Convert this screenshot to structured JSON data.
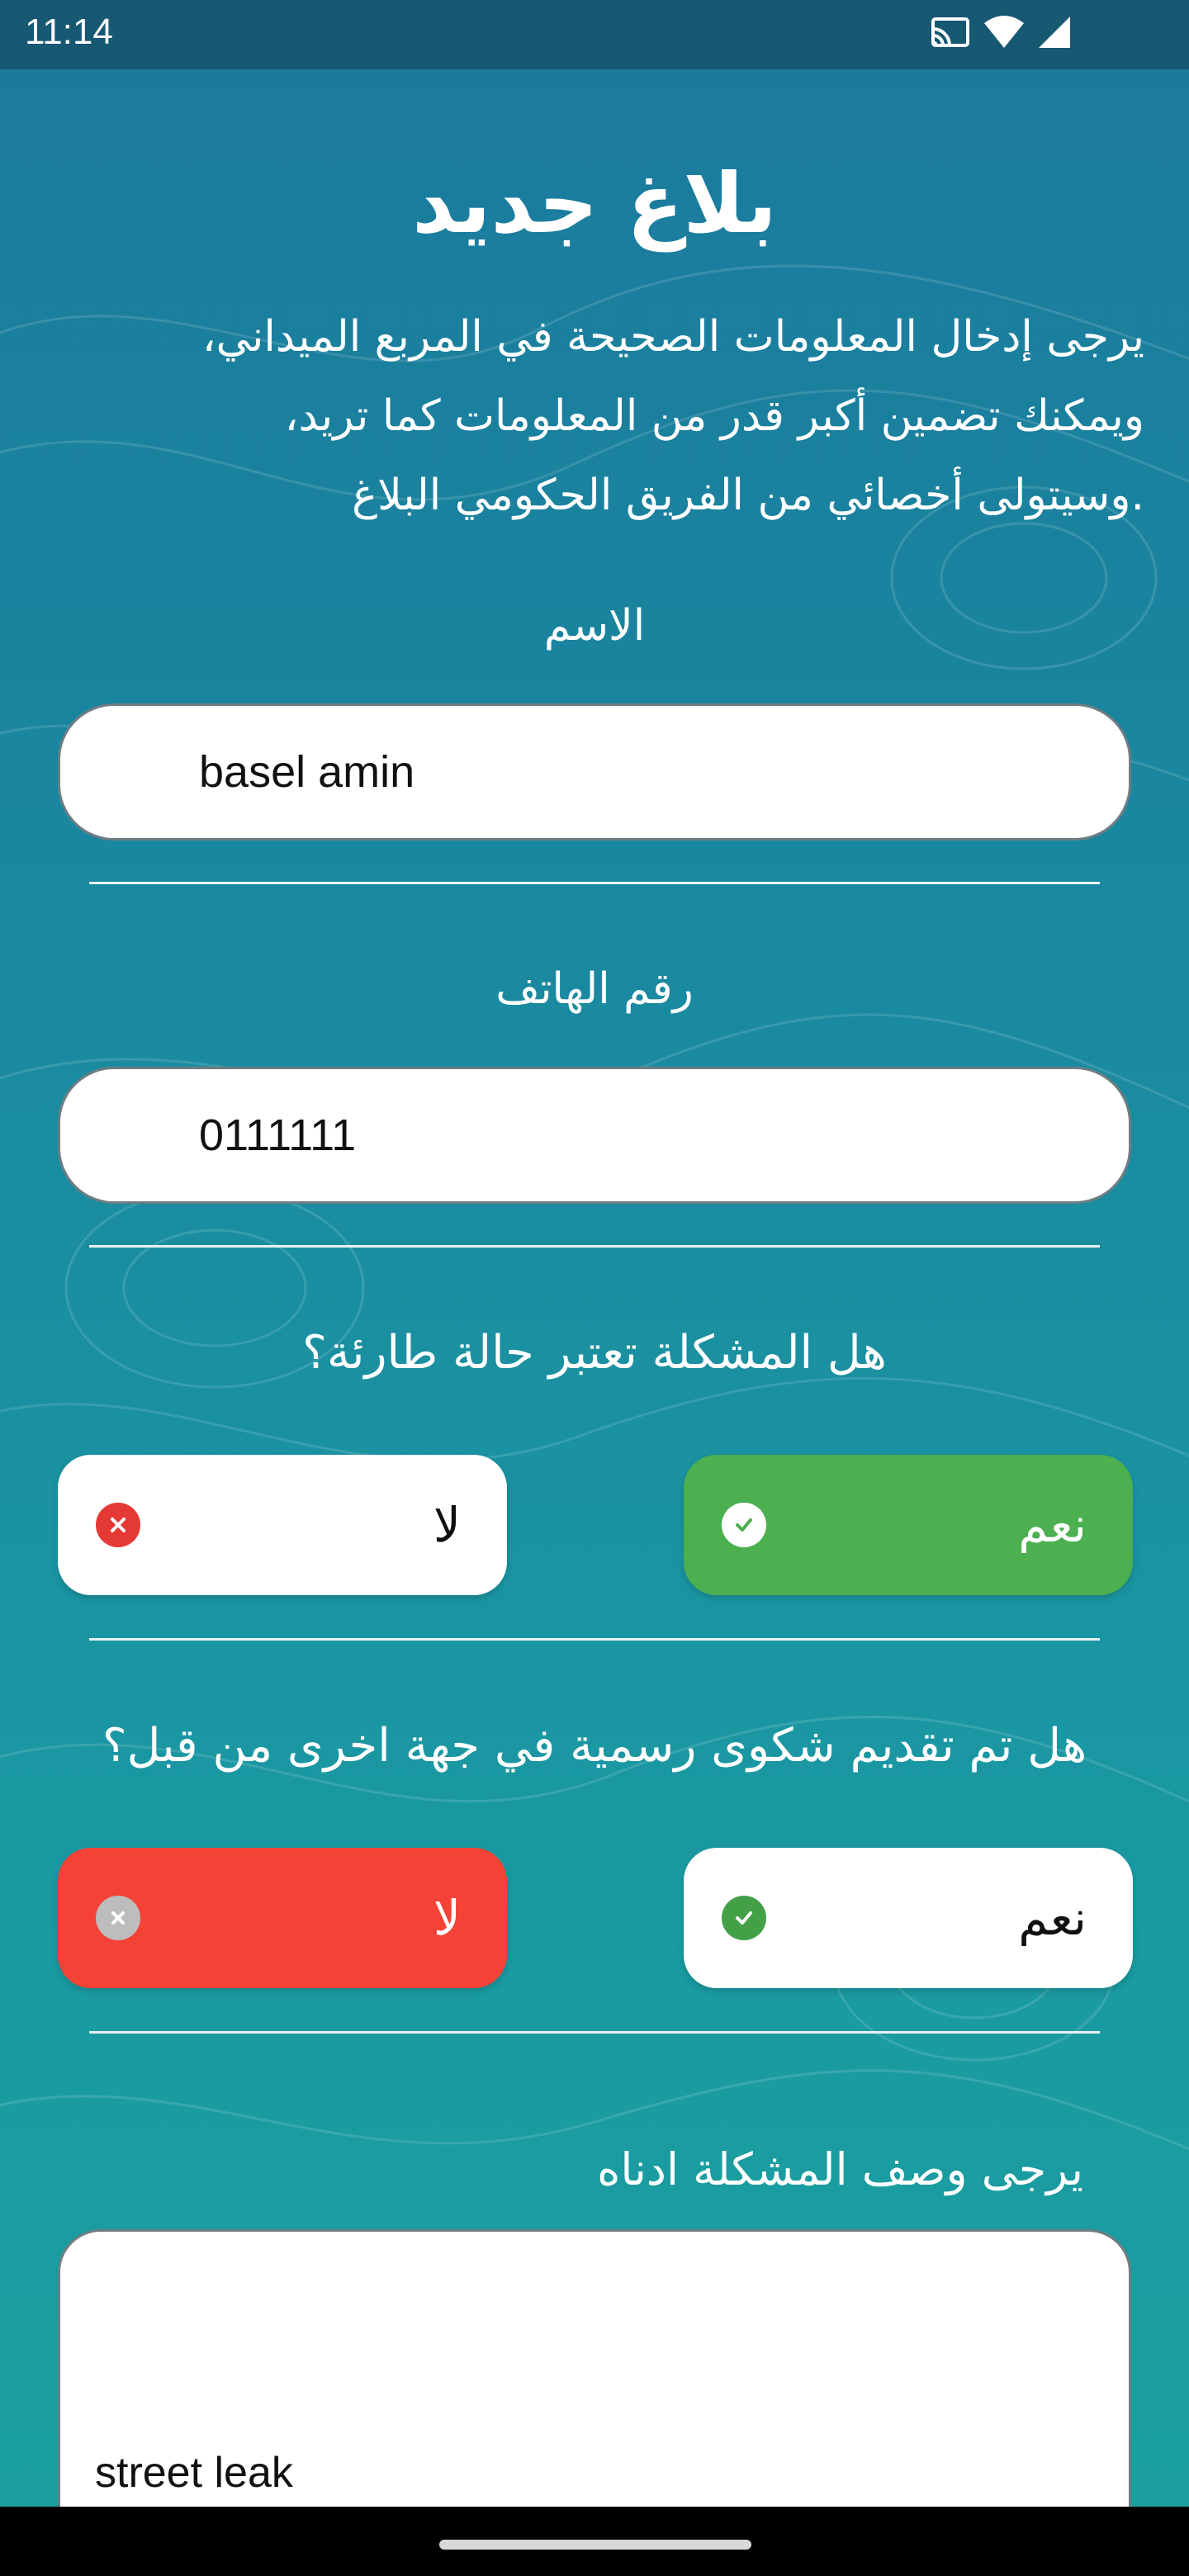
{
  "status_bar": {
    "time": "11:14",
    "icons": [
      "cast-icon",
      "wifi-icon",
      "signal-icon"
    ]
  },
  "form": {
    "title": "بلاغ جديد",
    "intro_lines": [
      "يرجى إدخال المعلومات الصحيحة في المربع الميداني،",
      "ويمكنك تضمين أكبر قدر من المعلومات كما تريد،",
      ".وسيتولى أخصائي من الفريق الحكومي البلاغ"
    ],
    "name": {
      "label": "الاسم",
      "value": "basel amin"
    },
    "phone": {
      "label": "رقم الهاتف",
      "value": "0111111"
    },
    "emergency": {
      "question": "هل المشكلة تعتبر حالة طارئة؟",
      "yes_label": "نعم",
      "no_label": "لا",
      "selected": "yes"
    },
    "prior_complaint": {
      "question": "هل تم تقديم شكوى رسمية في جهة اخرى من قبل؟",
      "yes_label": "نعم",
      "no_label": "لا",
      "selected": "no"
    },
    "description": {
      "label": "يرجى وصف المشكلة ادناه",
      "value": "street leak"
    }
  },
  "colors": {
    "background_top": "#1b7a9d",
    "background_bottom": "#1aa09e",
    "yes_selected": "#4caf50",
    "no_selected": "#f44336",
    "check_green": "#43a047",
    "cross_red": "#e53935",
    "field_border": "#6f7d82"
  }
}
